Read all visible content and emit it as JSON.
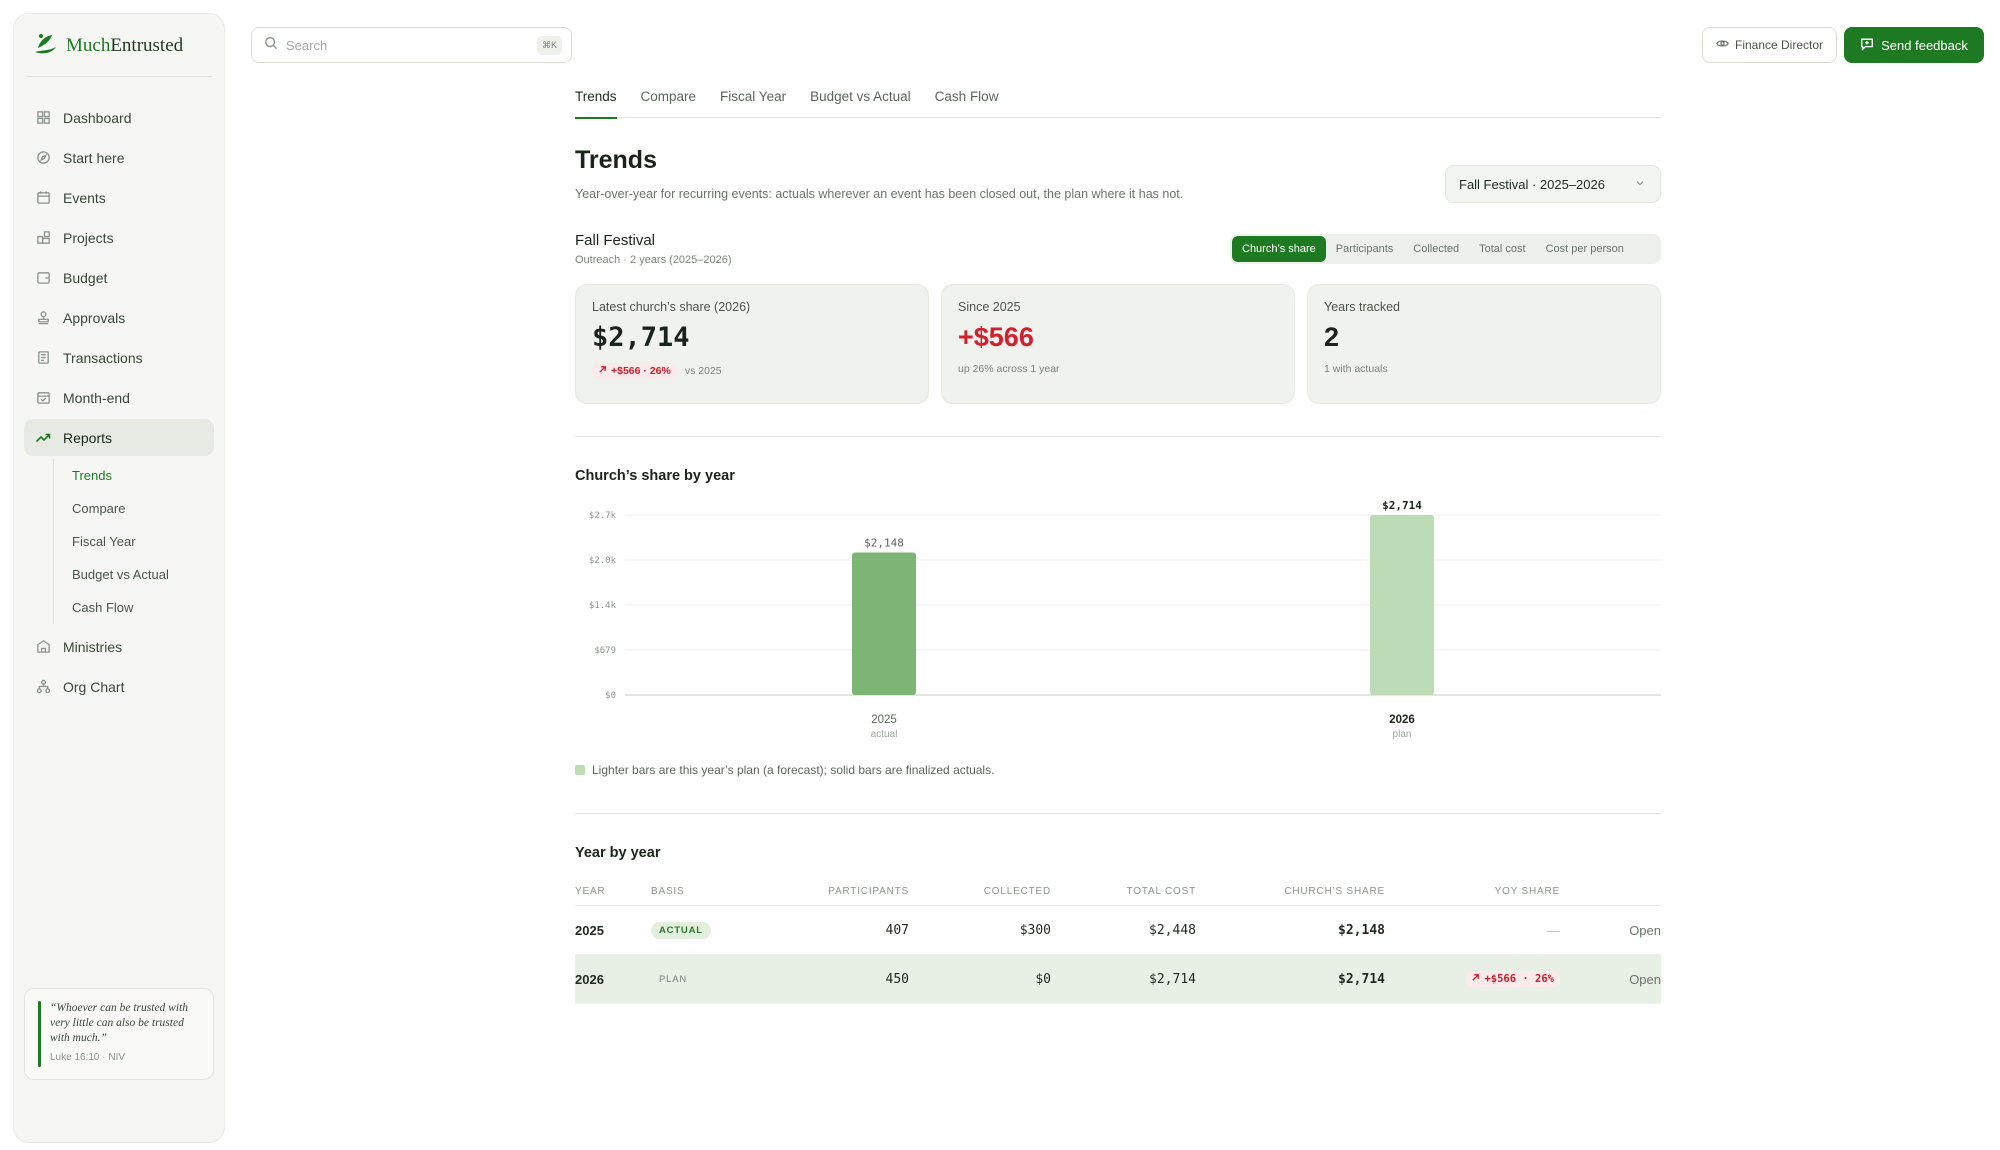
{
  "brand": {
    "name_part1": "Much",
    "name_part2": "Entrusted"
  },
  "sidebar": {
    "items": [
      {
        "label": "Dashboard",
        "icon": "grid-icon"
      },
      {
        "label": "Start here",
        "icon": "compass-icon"
      },
      {
        "label": "Events",
        "icon": "calendar-icon"
      },
      {
        "label": "Projects",
        "icon": "blocks-icon"
      },
      {
        "label": "Budget",
        "icon": "wallet-icon"
      },
      {
        "label": "Approvals",
        "icon": "stamp-icon"
      },
      {
        "label": "Transactions",
        "icon": "receipt-icon"
      },
      {
        "label": "Month-end",
        "icon": "calendar-check-icon"
      },
      {
        "label": "Reports",
        "icon": "trend-icon",
        "active": true
      }
    ],
    "reports_sub": [
      "Trends",
      "Compare",
      "Fiscal Year",
      "Budget vs Actual",
      "Cash Flow"
    ],
    "items_after": [
      {
        "label": "Ministries",
        "icon": "building-icon"
      },
      {
        "label": "Org Chart",
        "icon": "org-chart-icon"
      }
    ],
    "quote": {
      "text": "“Whoever can be trusted with very little can also be trusted with much.”",
      "ref": "Luke 16:10 · NIV"
    }
  },
  "topbar": {
    "search_placeholder": "Search",
    "search_shortcut": "⌘K",
    "role_label": "Finance Director",
    "feedback_label": "Send feedback"
  },
  "tabs": [
    "Trends",
    "Compare",
    "Fiscal Year",
    "Budget vs Actual",
    "Cash Flow"
  ],
  "page": {
    "title": "Trends",
    "subtitle": "Year-over-year for recurring events: actuals wherever an event has been closed out, the plan where it has not.",
    "event_select": "Fall Festival · 2025–2026",
    "event_name": "Fall Festival",
    "event_meta": "Outreach · 2 years (2025–2026)",
    "metrics": [
      "Church’s share",
      "Participants",
      "Collected",
      "Total cost",
      "Cost per person"
    ]
  },
  "cards": [
    {
      "label": "Latest church’s share (2026)",
      "value": "$2,714",
      "pill": "+$566 · 26%",
      "foot": "vs 2025"
    },
    {
      "label": "Since 2025",
      "value": "+$566",
      "foot": "up 26% across 1 year"
    },
    {
      "label": "Years tracked",
      "value": "2",
      "foot": "1 with actuals"
    }
  ],
  "chart_section_title": "Church’s share by year",
  "chart_data": {
    "type": "bar",
    "title": "Church’s share by year",
    "categories": [
      "2025",
      "2026"
    ],
    "category_sublabels": [
      "actual",
      "plan"
    ],
    "values": [
      2148,
      2714
    ],
    "value_labels": [
      "$2,148",
      "$2,714"
    ],
    "y_ticks": [
      0,
      679,
      1357,
      2036,
      2714
    ],
    "y_tick_labels": [
      "$0",
      "$679",
      "$1.4k",
      "$2.0k",
      "$2.7k"
    ],
    "ylim": [
      0,
      2714
    ],
    "grid": true,
    "colors": {
      "actual": "#7db574",
      "plan": "#bcdcb6"
    }
  },
  "legend_text": "Lighter bars are this year’s plan (a forecast); solid bars are finalized actuals.",
  "table": {
    "title": "Year by year",
    "headers": [
      "YEAR",
      "BASIS",
      "PARTICIPANTS",
      "COLLECTED",
      "TOTAL COST",
      "CHURCH’S SHARE",
      "YOY SHARE"
    ],
    "rows": [
      {
        "year": "2025",
        "basis": "ACTUAL",
        "participants": "407",
        "collected": "$300",
        "total_cost": "$2,448",
        "share": "$2,148",
        "yoy": "—",
        "action": "Open"
      },
      {
        "year": "2026",
        "basis": "PLAN",
        "participants": "450",
        "collected": "$0",
        "total_cost": "$2,714",
        "share": "$2,714",
        "yoy": "+$566 · 26%",
        "action": "Open"
      }
    ]
  }
}
